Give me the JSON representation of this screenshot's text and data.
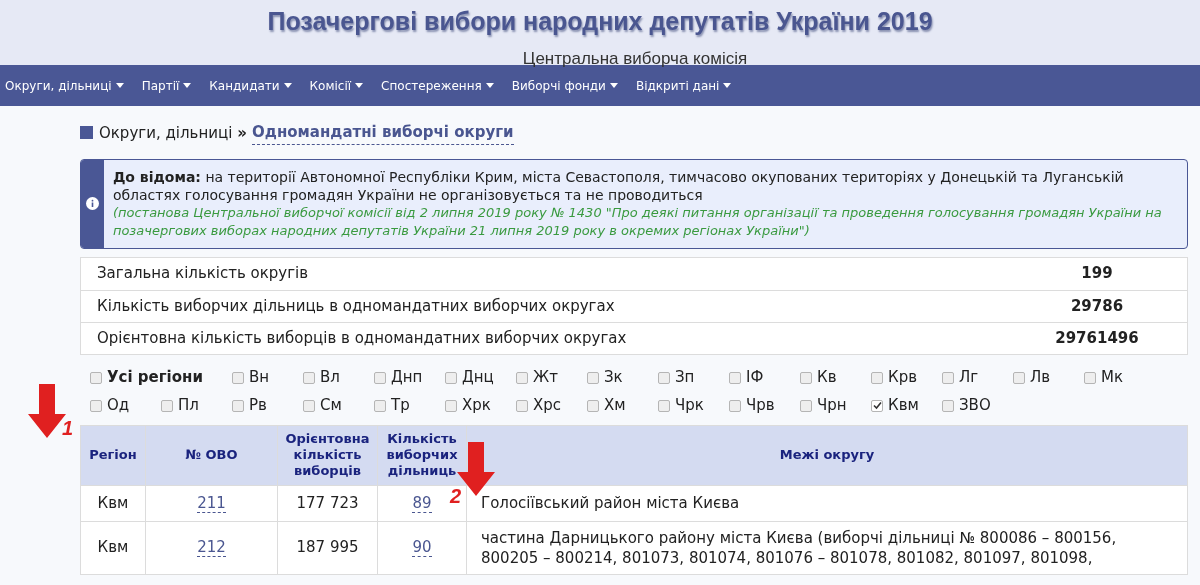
{
  "header": {
    "title": "Позачергові вибори народних депутатів України 2019",
    "subtitle": "Центральна виборча комісія"
  },
  "nav": [
    {
      "label": "Округи, дільниці"
    },
    {
      "label": "Партії"
    },
    {
      "label": "Кандидати"
    },
    {
      "label": "Комісії"
    },
    {
      "label": "Спостереження"
    },
    {
      "label": "Виборчі фонди"
    },
    {
      "label": "Відкриті дані"
    }
  ],
  "breadcrumb": {
    "parent": "Округи, дільниці",
    "separator": "»",
    "current": "Одномандатні виборчі округи"
  },
  "notice": {
    "lead": "До відома:",
    "text": "на території Автономної Республіки Крим, міста Севастополя, тимчасово окупованих територіях у Донецькій та Луганській областях голосування громадян України не організовується та не проводиться",
    "note": "(постанова Центральної виборчої комісії від 2 липня 2019 року № 1430 \"Про деякі питання організації та проведення голосування громадян України на позачергових виборах народних депутатів України 21 липня 2019 року в окремих регіонах України\")"
  },
  "stats": [
    {
      "label": "Загальна кількість округів",
      "value": "199"
    },
    {
      "label": "Кількість виборчих дільниць в одномандатних виборчих округах",
      "value": "29786"
    },
    {
      "label": "Орієнтовна кількість виборців в одномандатних виборчих округах",
      "value": "29761496"
    }
  ],
  "regions": [
    {
      "kind": "all",
      "label": "Усі регіони",
      "checked": false
    },
    {
      "kind": "region",
      "label": "Вн",
      "checked": false
    },
    {
      "kind": "region",
      "label": "Вл",
      "checked": false
    },
    {
      "kind": "region",
      "label": "Днп",
      "checked": false
    },
    {
      "kind": "region",
      "label": "Днц",
      "checked": false
    },
    {
      "kind": "region",
      "label": "Жт",
      "checked": false
    },
    {
      "kind": "region",
      "label": "Зк",
      "checked": false
    },
    {
      "kind": "region",
      "label": "Зп",
      "checked": false
    },
    {
      "kind": "region",
      "label": "ІФ",
      "checked": false
    },
    {
      "kind": "region",
      "label": "Кв",
      "checked": false
    },
    {
      "kind": "region",
      "label": "Крв",
      "checked": false
    },
    {
      "kind": "region",
      "label": "Лг",
      "checked": false
    },
    {
      "kind": "region",
      "label": "Лв",
      "checked": false
    },
    {
      "kind": "region",
      "label": "Мк",
      "checked": false
    },
    {
      "kind": "region",
      "label": "Од",
      "checked": false
    },
    {
      "kind": "region",
      "label": "Пл",
      "checked": false
    },
    {
      "kind": "region",
      "label": "Рв",
      "checked": false
    },
    {
      "kind": "region",
      "label": "См",
      "checked": false
    },
    {
      "kind": "region",
      "label": "Тр",
      "checked": false
    },
    {
      "kind": "region",
      "label": "Хрк",
      "checked": false
    },
    {
      "kind": "region",
      "label": "Хрс",
      "checked": false
    },
    {
      "kind": "region",
      "label": "Хм",
      "checked": false
    },
    {
      "kind": "region",
      "label": "Чрк",
      "checked": false
    },
    {
      "kind": "region",
      "label": "Чрв",
      "checked": false
    },
    {
      "kind": "region",
      "label": "Чрн",
      "checked": false
    },
    {
      "kind": "region",
      "label": "Квм",
      "checked": true
    },
    {
      "kind": "region",
      "label": "ЗВО",
      "checked": false
    }
  ],
  "table": {
    "columns": [
      "Регіон",
      "№ ОВО",
      "Орієнтовна кількість виборців",
      "Кількість виборчих дільниць",
      "Межі округу"
    ],
    "rows": [
      {
        "region": "Квм",
        "number": "211",
        "voters": "177 723",
        "stations": "89",
        "bounds": [
          "Голосіївський район міста Києва"
        ]
      },
      {
        "region": "Квм",
        "number": "212",
        "voters": "187 995",
        "stations": "90",
        "bounds": [
          "частина Дарницького району міста Києва (виборчі дільниці № 800086 – 800156,",
          "800205 – 800214, 801073, 801074, 801076 – 801078, 801082, 801097, 801098,"
        ]
      }
    ]
  },
  "annotations": [
    {
      "label": "1"
    },
    {
      "label": "2"
    }
  ]
}
